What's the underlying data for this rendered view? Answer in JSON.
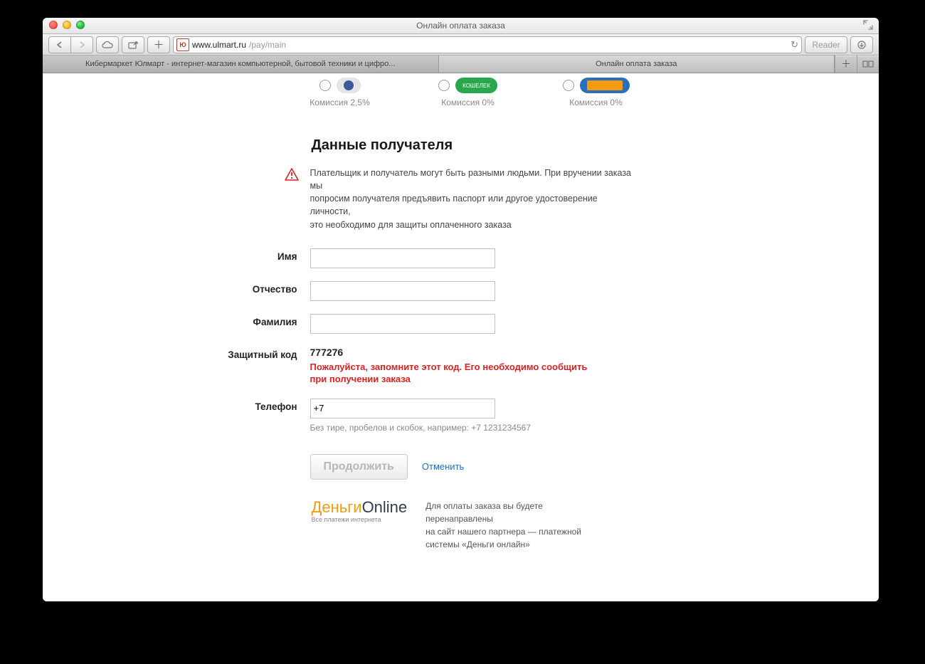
{
  "window": {
    "title": "Онлайн оплата заказа"
  },
  "addressbar": {
    "domain": "www.ulmart.ru",
    "path": "/pay/main",
    "reader_label": "Reader"
  },
  "tabs": [
    {
      "label": "Кибермаркет Юлмарт - интернет-магазин компьютерной, бытовой техники и цифро...",
      "active": false
    },
    {
      "label": "Онлайн оплата заказа",
      "active": true
    }
  ],
  "pay_options": [
    {
      "commission": "Комиссия 2,5%"
    },
    {
      "commission": "Комиссия 0%"
    },
    {
      "commission": "Комиссия 0%"
    }
  ],
  "section_title": "Данные получателя",
  "notice": {
    "line1": "Плательщик и получатель могут быть разными людьми. При вручении заказа мы",
    "line2": "попросим получателя предъявить паспорт или другое удостоверение личности,",
    "line3": "это необходимо для защиты оплаченного заказа"
  },
  "form": {
    "first_name_label": "Имя",
    "patronymic_label": "Отчество",
    "last_name_label": "Фамилия",
    "code_label": "Защитный код",
    "code_value": "777276",
    "code_warning": "Пожалуйста, запомните этот код. Его необходимо сообщить при получении заказа",
    "phone_label": "Телефон",
    "phone_value": "+7",
    "phone_hint": "Без тире, пробелов и скобок, например: +7 1231234567"
  },
  "actions": {
    "continue": "Продолжить",
    "cancel": "Отменить"
  },
  "partner": {
    "logo_a": "Деньги",
    "logo_b": "Online",
    "logo_sub": "Все платежи интернета",
    "line1": "Для оплаты заказа вы будете перенаправлены",
    "line2": "на сайт нашего партнера — платежной системы «Деньги онлайн»"
  }
}
